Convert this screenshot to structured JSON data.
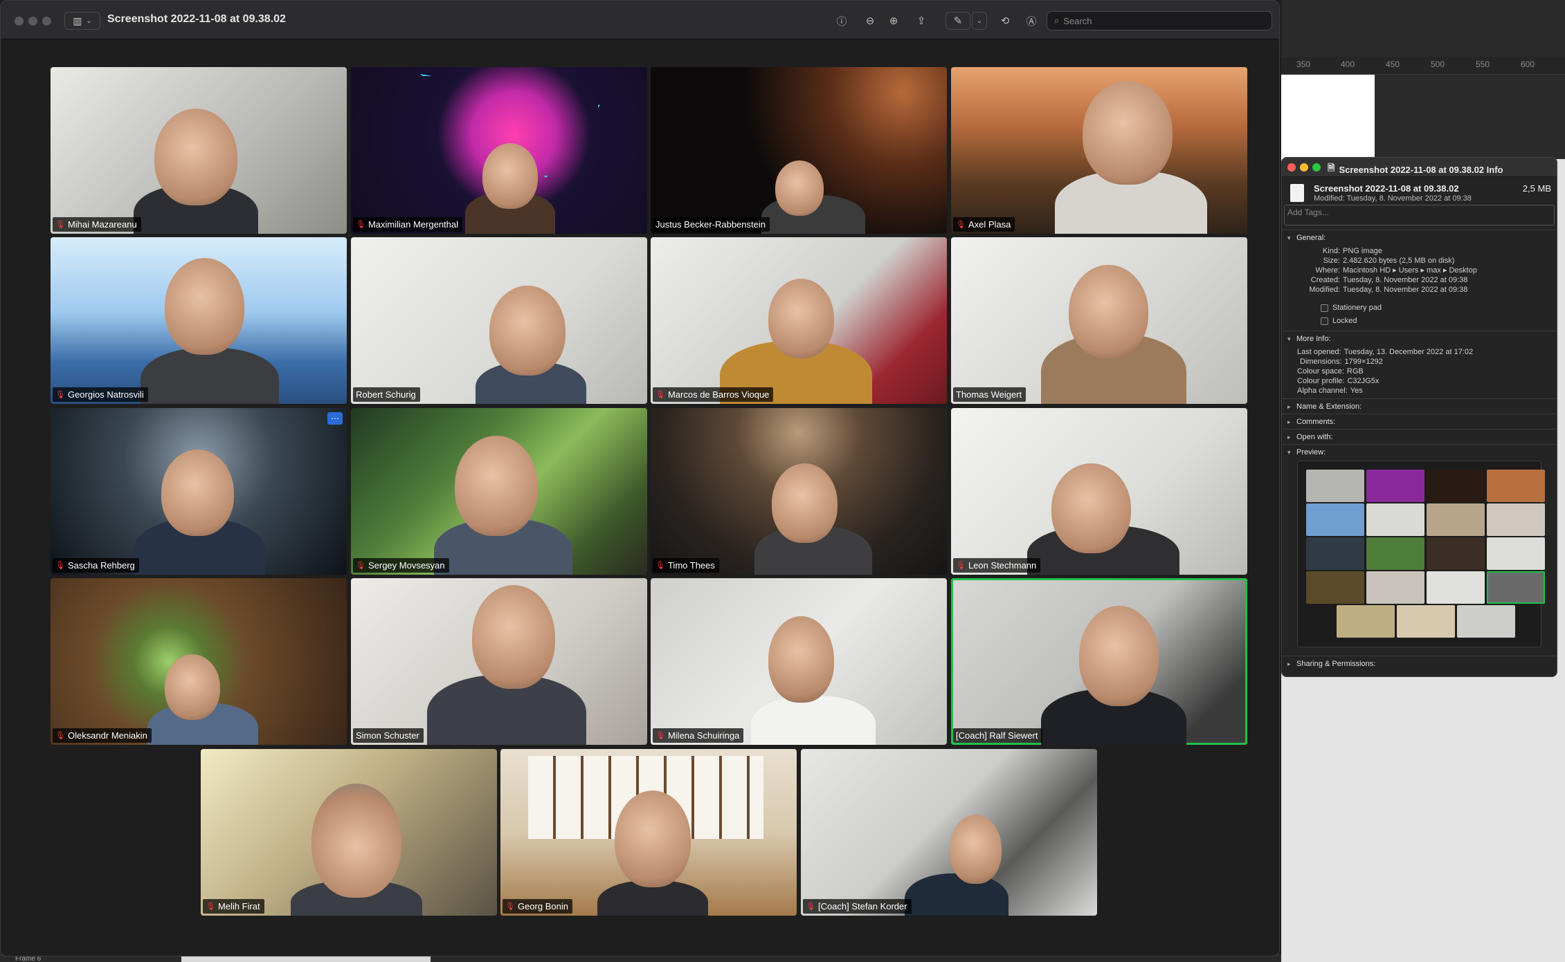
{
  "window": {
    "title": "Screenshot 2022-11-08 at 09.38.02",
    "search_placeholder": "Search",
    "toolbar_icons": [
      "info-icon",
      "zoom-out-icon",
      "zoom-in-icon",
      "share-icon",
      "markup-icon",
      "chevron-down-icon",
      "rotate-icon",
      "annotate-icon"
    ]
  },
  "ruler": {
    "ticks": [
      "350",
      "400",
      "450",
      "500",
      "550",
      "600"
    ]
  },
  "frame_label": "Frame 6",
  "participants": [
    {
      "name": "Mihai Mazareanu",
      "muted": true
    },
    {
      "name": "Maximilian Mergenthal",
      "muted": true
    },
    {
      "name": "Justus Becker-Rabbenstein",
      "muted": false
    },
    {
      "name": "Axel Plasa",
      "muted": true
    },
    {
      "name": "Georgios Natrosvili",
      "muted": true
    },
    {
      "name": "Robert Schurig",
      "muted": false
    },
    {
      "name": "Marcos de Barros Vioque",
      "muted": true
    },
    {
      "name": "Thomas Weigert",
      "muted": false
    },
    {
      "name": "Sascha Rehberg",
      "muted": true
    },
    {
      "name": "Sergey Movsesyan",
      "muted": true
    },
    {
      "name": "Timo Thees",
      "muted": true
    },
    {
      "name": "Leon Stechmann",
      "muted": true
    },
    {
      "name": "Oleksandr Meniakin",
      "muted": true
    },
    {
      "name": "Simon Schuster",
      "muted": false
    },
    {
      "name": "Milena Schuiringa",
      "muted": true
    },
    {
      "name": "[Coach] Ralf Siewert",
      "muted": false,
      "speaking": true
    },
    {
      "name": "Melih Firat",
      "muted": true
    },
    {
      "name": "Georg Bonin",
      "muted": true
    },
    {
      "name": "[Coach] Stefan Korder",
      "muted": true
    }
  ],
  "info_panel": {
    "title": "Screenshot 2022-11-08 at 09.38.02 Info",
    "file_name": "Screenshot 2022-11-08 at 09.38.02",
    "file_size": "2,5 MB",
    "modified_line": "Modified: Tuesday, 8. November 2022 at 09:38",
    "tags_placeholder": "Add Tags...",
    "general_label": "General:",
    "general": [
      {
        "k": "Kind:",
        "v": "PNG image"
      },
      {
        "k": "Size:",
        "v": "2.482.620 bytes (2,5 MB on disk)"
      },
      {
        "k": "Where:",
        "v": "Macintosh HD ▸ Users ▸ max ▸ Desktop"
      },
      {
        "k": "Created:",
        "v": "Tuesday, 8. November 2022 at 09:38"
      },
      {
        "k": "Modified:",
        "v": "Tuesday, 8. November 2022 at 09:38"
      }
    ],
    "stationery_label": "Stationery pad",
    "locked_label": "Locked",
    "more_info_label": "More Info:",
    "more_info": [
      {
        "k": "Last opened:",
        "v": "Tuesday, 13. December 2022 at 17:02"
      },
      {
        "k": "Dimensions:",
        "v": "1799×1292"
      },
      {
        "k": "Colour space:",
        "v": "RGB"
      },
      {
        "k": "Colour profile:",
        "v": "C32JG5x"
      },
      {
        "k": "Alpha channel:",
        "v": "Yes"
      }
    ],
    "collapsed_sections": [
      "Name & Extension:",
      "Comments:",
      "Open with:"
    ],
    "preview_label": "Preview:",
    "sharing_label": "Sharing & Permissions:"
  },
  "colors": {
    "speaking_outline": "#1fc24a",
    "muted_mic": "#ff3b3b",
    "more_button": "#2b6bd6"
  }
}
